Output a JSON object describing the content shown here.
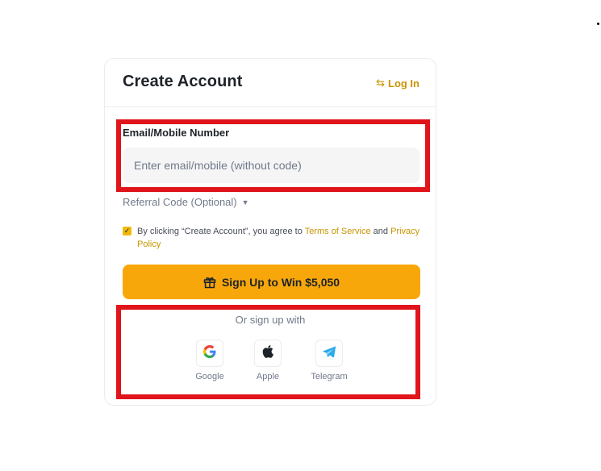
{
  "form": {
    "title": "Create Account",
    "login_label": "Log In",
    "login_icon": "swap-arrows-icon",
    "email_label": "Email/Mobile Number",
    "email_placeholder": "Enter email/mobile (without code)",
    "email_value": "",
    "referral_label": "Referral Code (Optional)",
    "agreement": {
      "checked": true,
      "prefix": "By clicking “Create Account”, you agree to ",
      "terms_link": "Terms of Service",
      "connector": " and ",
      "privacy_link": "Privacy Policy"
    },
    "signup_label": "Sign Up to Win $5,050",
    "signup_icon": "gift-icon",
    "or_label": "Or sign up with",
    "social": [
      {
        "label": "Google",
        "icon": "google-icon"
      },
      {
        "label": "Apple",
        "icon": "apple-icon"
      },
      {
        "label": "Telegram",
        "icon": "telegram-icon"
      }
    ]
  },
  "colors": {
    "accent": "#f8a70a",
    "link": "#c99400",
    "highlight": "#e0141b",
    "input_bg": "#f5f5f5"
  }
}
